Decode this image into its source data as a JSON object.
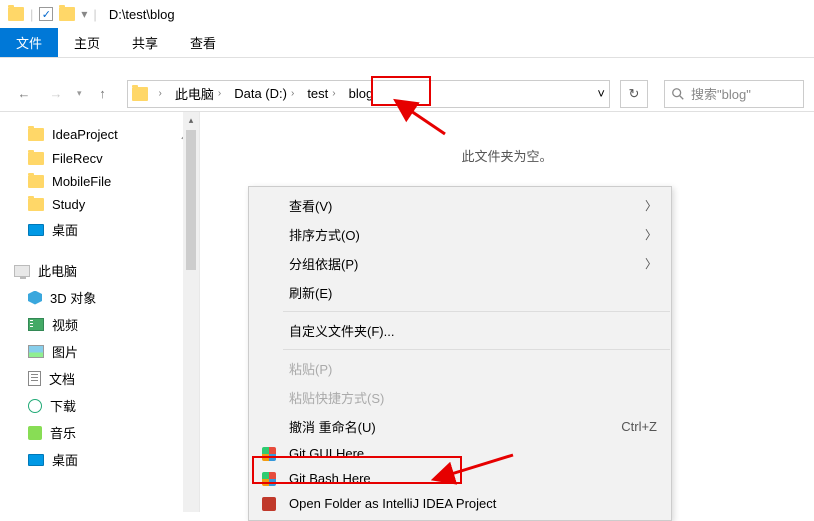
{
  "title": "D:\\test\\blog",
  "ribbon": {
    "file": "文件",
    "home": "主页",
    "share": "共享",
    "view": "查看"
  },
  "breadcrumb": [
    "此电脑",
    "Data (D:)",
    "test",
    "blog"
  ],
  "search_placeholder": "搜索\"blog\"",
  "empty_message": "此文件夹为空。",
  "sidebar": {
    "quick": [
      "IdeaProject",
      "FileRecv",
      "MobileFile",
      "Study",
      "桌面"
    ],
    "pc_label": "此电脑",
    "pc_items": [
      "3D 对象",
      "视频",
      "图片",
      "文档",
      "下载",
      "音乐",
      "桌面"
    ]
  },
  "ctx": {
    "view": "查看(V)",
    "sort": "排序方式(O)",
    "group": "分组依据(P)",
    "refresh": "刷新(E)",
    "custom": "自定义文件夹(F)...",
    "paste": "粘贴(P)",
    "paste_shortcut": "粘贴快捷方式(S)",
    "undo": "撤消 重命名(U)",
    "undo_key": "Ctrl+Z",
    "git_gui": "Git GUI Here",
    "git_bash": "Git Bash Here",
    "intellij": "Open Folder as IntelliJ IDEA Project"
  }
}
